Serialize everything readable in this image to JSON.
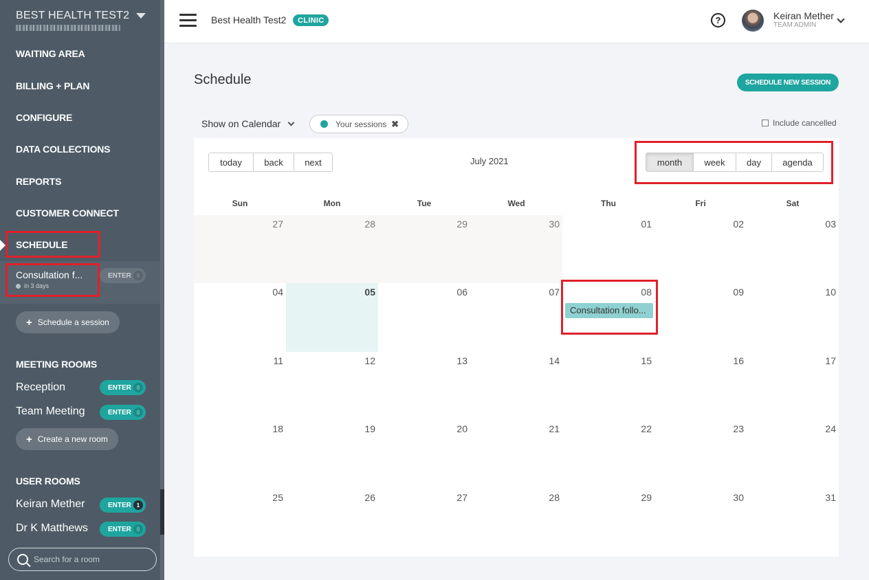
{
  "sidebar": {
    "org_name": "BEST HEALTH TEST2",
    "nav": [
      "WAITING AREA",
      "BILLING + PLAN",
      "CONFIGURE",
      "DATA COLLECTIONS",
      "REPORTS",
      "CUSTOMER CONNECT",
      "SCHEDULE"
    ],
    "upcoming_session": {
      "title": "Consultation f...",
      "when": "in 3 days",
      "enter_label": "ENTER",
      "count": "0"
    },
    "schedule_btn": "Schedule a session",
    "meeting_rooms_title": "MEETING ROOMS",
    "meeting_rooms": [
      {
        "name": "Reception",
        "enter": "ENTER",
        "count": "0"
      },
      {
        "name": "Team Meeting",
        "enter": "ENTER",
        "count": "0"
      }
    ],
    "create_room_btn": "Create a new room",
    "user_rooms_title": "USER ROOMS",
    "user_rooms": [
      {
        "name": "Keiran Mether",
        "enter": "ENTER",
        "count": "1"
      },
      {
        "name": "Dr K Matthews",
        "enter": "ENTER",
        "count": "0"
      }
    ],
    "search_placeholder": "Search for a room"
  },
  "topbar": {
    "org_title": "Best Health Test2",
    "badge": "CLINIC",
    "help": "?",
    "user_name": "Keiran Mether",
    "user_role": "TEAM ADMIN"
  },
  "main": {
    "title": "Schedule",
    "new_session_btn": "SCHEDULE NEW SESSION",
    "show_on_calendar": "Show on Calendar",
    "filter_chip": "Your sessions",
    "filter_chip_close": "✖",
    "include_cancelled": "Include cancelled"
  },
  "calendar": {
    "nav_buttons": [
      "today",
      "back",
      "next"
    ],
    "label": "July 2021",
    "views": [
      "month",
      "week",
      "day",
      "agenda"
    ],
    "active_view": "month",
    "day_names": [
      "Sun",
      "Mon",
      "Tue",
      "Wed",
      "Thu",
      "Fri",
      "Sat"
    ],
    "weeks": [
      [
        "27",
        "28",
        "29",
        "30",
        "01",
        "02",
        "03"
      ],
      [
        "04",
        "05",
        "06",
        "07",
        "08",
        "09",
        "10"
      ],
      [
        "11",
        "12",
        "13",
        "14",
        "15",
        "16",
        "17"
      ],
      [
        "18",
        "19",
        "20",
        "21",
        "22",
        "23",
        "24"
      ],
      [
        "25",
        "26",
        "27",
        "28",
        "29",
        "30",
        "31"
      ]
    ],
    "today": "05",
    "event": {
      "date": "08",
      "title": "Consultation follo..."
    }
  },
  "colors": {
    "accent": "#1fa59f",
    "sidebar": "#4e5b66",
    "highlight": "#e0202a",
    "event": "#8fd0d0"
  }
}
